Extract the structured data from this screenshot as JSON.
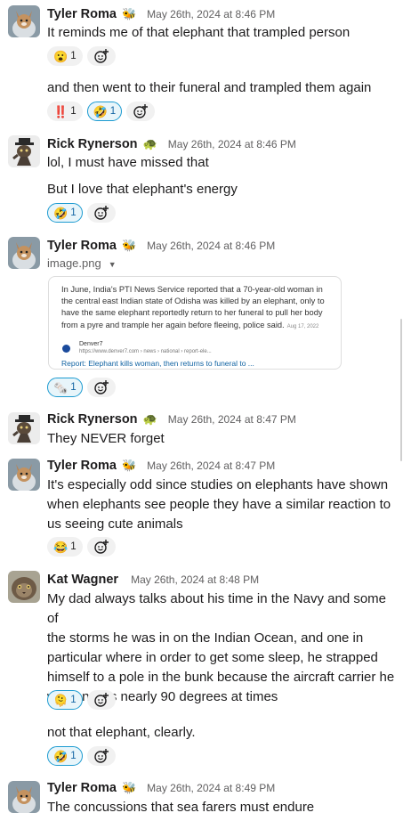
{
  "messages": [
    {
      "author": "Tyler Roma",
      "status_emoji": "🐝",
      "time": "May 26th, 2024 at 8:46 PM",
      "lines": [
        "It reminds me of that elephant that trampled person"
      ],
      "reactions": [
        {
          "emoji": "😮",
          "count": "1"
        }
      ]
    },
    {
      "lines": [
        "and then went to their funeral and trampled them again"
      ],
      "reactions": [
        {
          "emoji": "‼️",
          "count": "1"
        },
        {
          "emoji": "🤣",
          "count": "1"
        }
      ]
    },
    {
      "author": "Rick Rynerson",
      "status_emoji": "🐢",
      "time": "May 26th, 2024 at 8:46 PM",
      "lines": [
        "lol, I must have missed that"
      ]
    },
    {
      "lines": [
        "But I love that elephant's energy"
      ],
      "reactions": [
        {
          "emoji": "🤣",
          "count": "1"
        }
      ]
    },
    {
      "author": "Tyler Roma",
      "status_emoji": "🐝",
      "time": "May 26th, 2024 at 8:46 PM",
      "filename": "image.png",
      "preview": {
        "text": "In June, India's PTI News Service reported that a 70-year-old woman in the central east Indian state of Odisha was killed by an elephant, only to have the same elephant reportedly return to her funeral to pull her body from a pyre and trample her again before fleeing, police said.",
        "date": "Aug 17, 2022",
        "source_name": "Denver7",
        "source_url": "https://www.denver7.com › news › national › report-ele...",
        "link": "Report: Elephant kills woman, then returns to funeral to ..."
      },
      "reactions": [
        {
          "emoji": "🗞️",
          "count": "1"
        }
      ]
    },
    {
      "author": "Rick Rynerson",
      "status_emoji": "🐢",
      "time": "May 26th, 2024 at 8:47 PM",
      "lines": [
        "They NEVER forget"
      ]
    },
    {
      "author": "Tyler Roma",
      "status_emoji": "🐝",
      "time": "May 26th, 2024 at 8:47 PM",
      "lines": [
        "It's especially odd since studies on elephants have shown",
        "when elephants see people they have a similar reaction to",
        "us seeing cute animals"
      ],
      "reactions": [
        {
          "emoji": "😂",
          "count": "1"
        }
      ]
    },
    {
      "author": "Kat Wagner",
      "time": "May 26th, 2024 at 8:48 PM",
      "lines": [
        "My dad always talks about his time in the Navy and some of",
        "the storms he was in on the Indian Ocean, and one in",
        "particular where in order to get some sleep, he strapped",
        "himself to a pole in the bunk because the aircraft carrier he",
        "was on was nearly 90 degrees at times"
      ],
      "reactions": [
        {
          "emoji": "🫠",
          "count": "1"
        }
      ]
    },
    {
      "lines": [
        "not that elephant, clearly."
      ],
      "reactions": [
        {
          "emoji": "🤣",
          "count": "1"
        }
      ]
    },
    {
      "author": "Tyler Roma",
      "status_emoji": "🐝",
      "time": "May 26th, 2024 at 8:49 PM",
      "lines": [
        "The concussions that sea farers must endure"
      ]
    }
  ]
}
